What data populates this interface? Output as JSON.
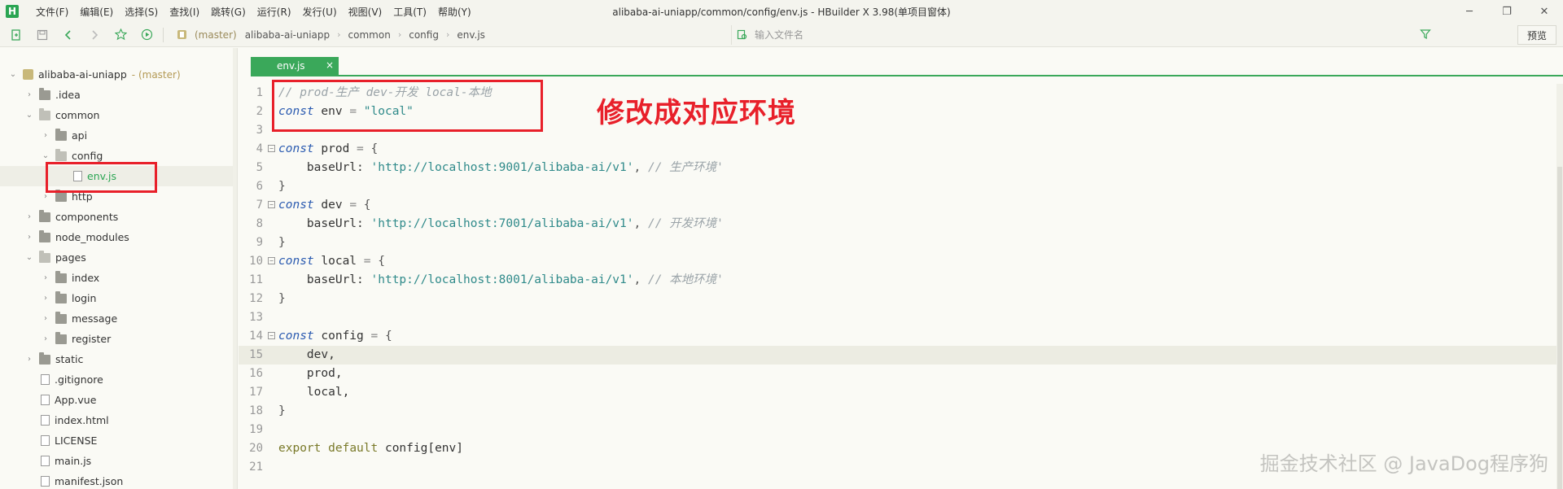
{
  "app": {
    "logo": "H",
    "window_title": "alibaba-ai-uniapp/common/config/env.js - HBuilder X 3.98(单项目窗体)"
  },
  "menu": [
    "文件(F)",
    "编辑(E)",
    "选择(S)",
    "查找(I)",
    "跳转(G)",
    "运行(R)",
    "发行(U)",
    "视图(V)",
    "工具(T)",
    "帮助(Y)"
  ],
  "window_controls": {
    "minimize": "─",
    "restore": "❐",
    "close": "✕"
  },
  "toolbar": {
    "breadcrumb": {
      "branch": "(master)",
      "path": [
        "alibaba-ai-uniapp",
        "common",
        "config",
        "env.js"
      ]
    },
    "file_search_placeholder": "输入文件名",
    "preview_label": "预览"
  },
  "sidebar": {
    "project": {
      "name": "alibaba-ai-uniapp",
      "branch": "- (master)"
    },
    "items": [
      {
        "label": ".idea",
        "type": "folder",
        "expanded": false,
        "depth": 1
      },
      {
        "label": "common",
        "type": "folder",
        "expanded": true,
        "depth": 1
      },
      {
        "label": "api",
        "type": "folder",
        "expanded": false,
        "depth": 2
      },
      {
        "label": "config",
        "type": "folder",
        "expanded": true,
        "depth": 2
      },
      {
        "label": "env.js",
        "type": "file",
        "depth": 3,
        "selected": true
      },
      {
        "label": "http",
        "type": "folder",
        "expanded": false,
        "depth": 2
      },
      {
        "label": "components",
        "type": "folder",
        "expanded": false,
        "depth": 1
      },
      {
        "label": "node_modules",
        "type": "folder",
        "expanded": false,
        "depth": 1
      },
      {
        "label": "pages",
        "type": "folder",
        "expanded": true,
        "depth": 1
      },
      {
        "label": "index",
        "type": "folder",
        "expanded": false,
        "depth": 2
      },
      {
        "label": "login",
        "type": "folder",
        "expanded": false,
        "depth": 2
      },
      {
        "label": "message",
        "type": "folder",
        "expanded": false,
        "depth": 2
      },
      {
        "label": "register",
        "type": "folder",
        "expanded": false,
        "depth": 2
      },
      {
        "label": "static",
        "type": "folder",
        "expanded": false,
        "depth": 1
      },
      {
        "label": ".gitignore",
        "type": "file",
        "depth": 1
      },
      {
        "label": "App.vue",
        "type": "file",
        "depth": 1
      },
      {
        "label": "index.html",
        "type": "file",
        "depth": 1
      },
      {
        "label": "LICENSE",
        "type": "file",
        "depth": 1
      },
      {
        "label": "main.js",
        "type": "file",
        "depth": 1
      },
      {
        "label": "manifest.json",
        "type": "file",
        "depth": 1
      }
    ]
  },
  "editor": {
    "tab": {
      "label": "env.js",
      "close": "×"
    },
    "current_line": 15,
    "lines": [
      {
        "n": "1",
        "fold": false,
        "tokens": [
          [
            "cm",
            "// prod-生产 dev-开发 local-本地"
          ]
        ]
      },
      {
        "n": "2",
        "fold": false,
        "tokens": [
          [
            "kw",
            "const"
          ],
          [
            "id",
            " env "
          ],
          [
            "op",
            "="
          ],
          [
            "id",
            " "
          ],
          [
            "str",
            "\"local\""
          ]
        ]
      },
      {
        "n": "3",
        "fold": false,
        "tokens": []
      },
      {
        "n": "4",
        "fold": true,
        "tokens": [
          [
            "kw",
            "const"
          ],
          [
            "id",
            " prod "
          ],
          [
            "op",
            "="
          ],
          [
            "id",
            " "
          ],
          [
            "pun",
            "{"
          ]
        ]
      },
      {
        "n": "5",
        "fold": false,
        "tokens": [
          [
            "id",
            "    baseUrl: "
          ],
          [
            "str",
            "'http://localhost:9001/alibaba-ai/v1'"
          ],
          [
            "pun",
            ", "
          ],
          [
            "cm",
            "// 生产环境'"
          ]
        ]
      },
      {
        "n": "6",
        "fold": false,
        "tokens": [
          [
            "pun",
            "}"
          ]
        ]
      },
      {
        "n": "7",
        "fold": true,
        "tokens": [
          [
            "kw",
            "const"
          ],
          [
            "id",
            " dev "
          ],
          [
            "op",
            "="
          ],
          [
            "id",
            " "
          ],
          [
            "pun",
            "{"
          ]
        ]
      },
      {
        "n": "8",
        "fold": false,
        "tokens": [
          [
            "id",
            "    baseUrl: "
          ],
          [
            "str",
            "'http://localhost:7001/alibaba-ai/v1'"
          ],
          [
            "pun",
            ", "
          ],
          [
            "cm",
            "// 开发环境'"
          ]
        ]
      },
      {
        "n": "9",
        "fold": false,
        "tokens": [
          [
            "pun",
            "}"
          ]
        ]
      },
      {
        "n": "10",
        "fold": true,
        "tokens": [
          [
            "kw",
            "const"
          ],
          [
            "id",
            " local "
          ],
          [
            "op",
            "="
          ],
          [
            "id",
            " "
          ],
          [
            "pun",
            "{"
          ]
        ]
      },
      {
        "n": "11",
        "fold": false,
        "tokens": [
          [
            "id",
            "    baseUrl: "
          ],
          [
            "str",
            "'http://localhost:8001/alibaba-ai/v1'"
          ],
          [
            "pun",
            ", "
          ],
          [
            "cm",
            "// 本地环境'"
          ]
        ]
      },
      {
        "n": "12",
        "fold": false,
        "tokens": [
          [
            "pun",
            "}"
          ]
        ]
      },
      {
        "n": "13",
        "fold": false,
        "tokens": []
      },
      {
        "n": "14",
        "fold": true,
        "tokens": [
          [
            "kw",
            "const"
          ],
          [
            "id",
            " config "
          ],
          [
            "op",
            "="
          ],
          [
            "id",
            " "
          ],
          [
            "pun",
            "{"
          ]
        ]
      },
      {
        "n": "15",
        "fold": false,
        "tokens": [
          [
            "id",
            "    dev,"
          ]
        ]
      },
      {
        "n": "16",
        "fold": false,
        "tokens": [
          [
            "id",
            "    prod,"
          ]
        ]
      },
      {
        "n": "17",
        "fold": false,
        "tokens": [
          [
            "id",
            "    local,"
          ]
        ]
      },
      {
        "n": "18",
        "fold": false,
        "tokens": [
          [
            "pun",
            "}"
          ]
        ]
      },
      {
        "n": "19",
        "fold": false,
        "tokens": []
      },
      {
        "n": "20",
        "fold": false,
        "tokens": [
          [
            "kw2",
            "export"
          ],
          [
            "id",
            " "
          ],
          [
            "kw2",
            "default"
          ],
          [
            "id",
            " config[env]"
          ]
        ]
      },
      {
        "n": "21",
        "fold": false,
        "tokens": []
      }
    ]
  },
  "annotation_text": "修改成对应环境",
  "watermark": "掘金技术社区 @ JavaDog程序狗",
  "colors": {
    "accent": "#3aa85a",
    "annotation": "#e8202a"
  }
}
